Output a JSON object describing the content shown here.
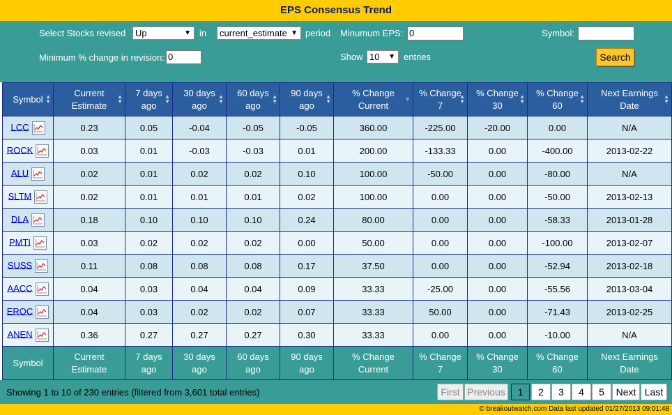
{
  "page_title": "EPS Consensus Trend",
  "filters": {
    "revised_label": "Select Stocks revised",
    "revised_value": "Up",
    "in_label": "in",
    "period_value": "current_estimate",
    "period_label": "period",
    "min_eps_label": "Minumum EPS:",
    "min_eps_value": "0",
    "symbol_label": "Symbol:",
    "symbol_value": "",
    "min_change_label": "Minimum % change in revision:",
    "min_change_value": "0",
    "show_label": "Show",
    "show_value": "10",
    "entries_label": "entries",
    "search_label": "Search"
  },
  "table": {
    "headers": [
      {
        "line1": "Symbol",
        "line2": ""
      },
      {
        "line1": "Current",
        "line2": "Estimate"
      },
      {
        "line1": "7 days",
        "line2": "ago"
      },
      {
        "line1": "30 days",
        "line2": "ago"
      },
      {
        "line1": "60 days",
        "line2": "ago"
      },
      {
        "line1": "90 days",
        "line2": "ago"
      },
      {
        "line1": "% Change",
        "line2": "Current"
      },
      {
        "line1": "% Change",
        "line2": "7"
      },
      {
        "line1": "% Change",
        "line2": "30"
      },
      {
        "line1": "% Change",
        "line2": "60"
      },
      {
        "line1": "Next Earnings",
        "line2": "Date"
      }
    ],
    "rows": [
      {
        "symbol": "LCC",
        "cells": [
          "0.23",
          "0.05",
          "-0.04",
          "-0.05",
          "-0.05",
          "360.00",
          "-225.00",
          "-20.00",
          "0.00",
          "N/A"
        ]
      },
      {
        "symbol": "ROCK",
        "cells": [
          "0.03",
          "0.01",
          "-0.03",
          "-0.03",
          "0.01",
          "200.00",
          "-133.33",
          "0.00",
          "-400.00",
          "2013-02-22"
        ]
      },
      {
        "symbol": "ALU",
        "cells": [
          "0.02",
          "0.01",
          "0.02",
          "0.02",
          "0.10",
          "100.00",
          "-50.00",
          "0.00",
          "-80.00",
          "N/A"
        ]
      },
      {
        "symbol": "SLTM",
        "cells": [
          "0.02",
          "0.01",
          "0.01",
          "0.01",
          "0.02",
          "100.00",
          "0.00",
          "0.00",
          "-50.00",
          "2013-02-13"
        ]
      },
      {
        "symbol": "DLA",
        "cells": [
          "0.18",
          "0.10",
          "0.10",
          "0.10",
          "0.24",
          "80.00",
          "0.00",
          "0.00",
          "-58.33",
          "2013-01-28"
        ]
      },
      {
        "symbol": "PMTI",
        "cells": [
          "0.03",
          "0.02",
          "0.02",
          "0.02",
          "0.00",
          "50.00",
          "0.00",
          "0.00",
          "-100.00",
          "2013-02-07"
        ]
      },
      {
        "symbol": "SUSS",
        "cells": [
          "0.11",
          "0.08",
          "0.08",
          "0.08",
          "0.17",
          "37.50",
          "0.00",
          "0.00",
          "-52.94",
          "2013-02-18"
        ]
      },
      {
        "symbol": "AACC",
        "cells": [
          "0.04",
          "0.03",
          "0.04",
          "0.04",
          "0.09",
          "33.33",
          "-25.00",
          "0.00",
          "-55.56",
          "2013-03-04"
        ]
      },
      {
        "symbol": "EROC",
        "cells": [
          "0.04",
          "0.03",
          "0.02",
          "0.02",
          "0.07",
          "33.33",
          "50.00",
          "0.00",
          "-71.43",
          "2013-02-25"
        ]
      },
      {
        "symbol": "ANEN",
        "cells": [
          "0.36",
          "0.27",
          "0.27",
          "0.27",
          "0.30",
          "33.33",
          "0.00",
          "0.00",
          "-10.00",
          "N/A"
        ]
      }
    ]
  },
  "info_text": "Showing 1 to 10 of 230 entries (filtered from 3,601 total entries)",
  "pagination": {
    "first": "First",
    "previous": "Previous",
    "pages": [
      "1",
      "2",
      "3",
      "4",
      "5"
    ],
    "next": "Next",
    "last": "Last"
  },
  "footer": "© breakoutwatch.com  Data last updated 01/27/2013 09:01:48",
  "icons": {
    "sort": "sort-both-icon",
    "sort_active": "sort-desc-icon",
    "chart": "line-chart-icon",
    "dropdown": "chevron-down-icon"
  },
  "colors": {
    "title_bar": "#fecc00",
    "panel": "#3a9c96",
    "header": "#2b5e9e",
    "row_odd": "#cfe6ef",
    "row_even": "#e8f4f8",
    "link": "#0000cc"
  }
}
